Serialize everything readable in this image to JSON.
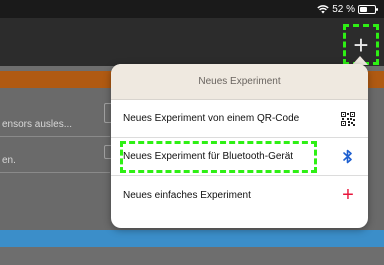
{
  "status_bar": {
    "wifi_icon": "wifi-icon",
    "battery_text": "52 %",
    "battery_level": 0.52
  },
  "nav_bar": {
    "add_button_label": "+"
  },
  "background_list": {
    "rows": [
      {
        "text": "ensors ausles..."
      },
      {
        "text": "en."
      }
    ],
    "section_header_color": "#b05a12",
    "bottom_bar_color": "#3b8ec9"
  },
  "popover": {
    "title": "Neues Experiment",
    "items": [
      {
        "label": "Neues Experiment von einem QR-Code",
        "icon": "qr-code-icon"
      },
      {
        "label": "Neues Experiment für Bluetooth-Gerät",
        "icon": "bluetooth-icon",
        "icon_glyph": "✱"
      },
      {
        "label": "Neues einfaches Experiment",
        "icon": "plus-icon",
        "icon_glyph": "+"
      }
    ]
  },
  "colors": {
    "highlight": "#2ef014",
    "bluetooth": "#1d5fd0",
    "plus": "#e8163c"
  }
}
